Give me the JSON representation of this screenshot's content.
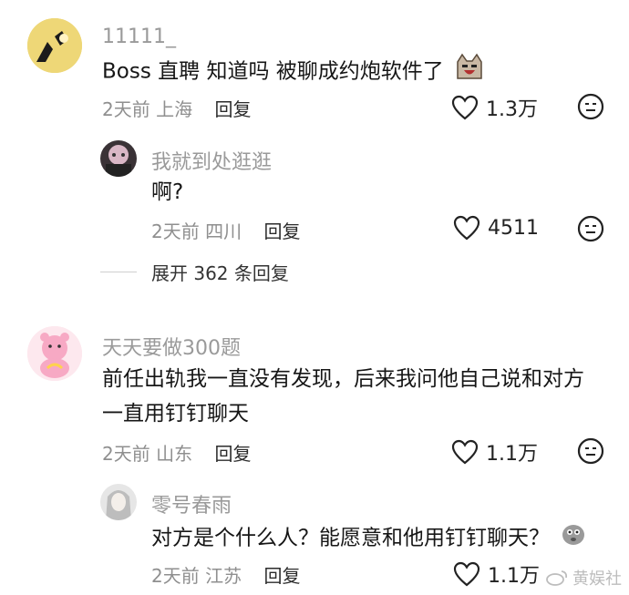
{
  "comments": [
    {
      "username": "11111_",
      "text": "Boss 直聘 知道吗 被聊成约炮软件了",
      "time": "2天前",
      "location": "上海",
      "reply_label": "回复",
      "likes": "1.3万",
      "replies": [
        {
          "username": "我就到处逛逛",
          "text": "啊?",
          "time": "2天前",
          "location": "四川",
          "reply_label": "回复",
          "likes": "4511"
        }
      ],
      "expand_label": "展开 362 条回复"
    },
    {
      "username": "天天要做300题",
      "text_line1": "前任出轨我一直没有发现，后来我问他自己说和对方",
      "text_line2": "一直用钉钉聊天",
      "time": "2天前",
      "location": "山东",
      "reply_label": "回复",
      "likes": "1.1万",
      "replies": [
        {
          "username": "零号春雨",
          "text": "对方是个什么人？能愿意和他用钉钉聊天？",
          "time": "2天前",
          "location": "江苏",
          "reply_label": "回复",
          "likes": "1.1万"
        }
      ]
    }
  ],
  "watermark": "黄娱社",
  "icons": {
    "like": "heart-outline-icon",
    "dislike": "meh-face-icon",
    "emoji1": "cat-emoji",
    "emoji2": "blob-emoji"
  }
}
